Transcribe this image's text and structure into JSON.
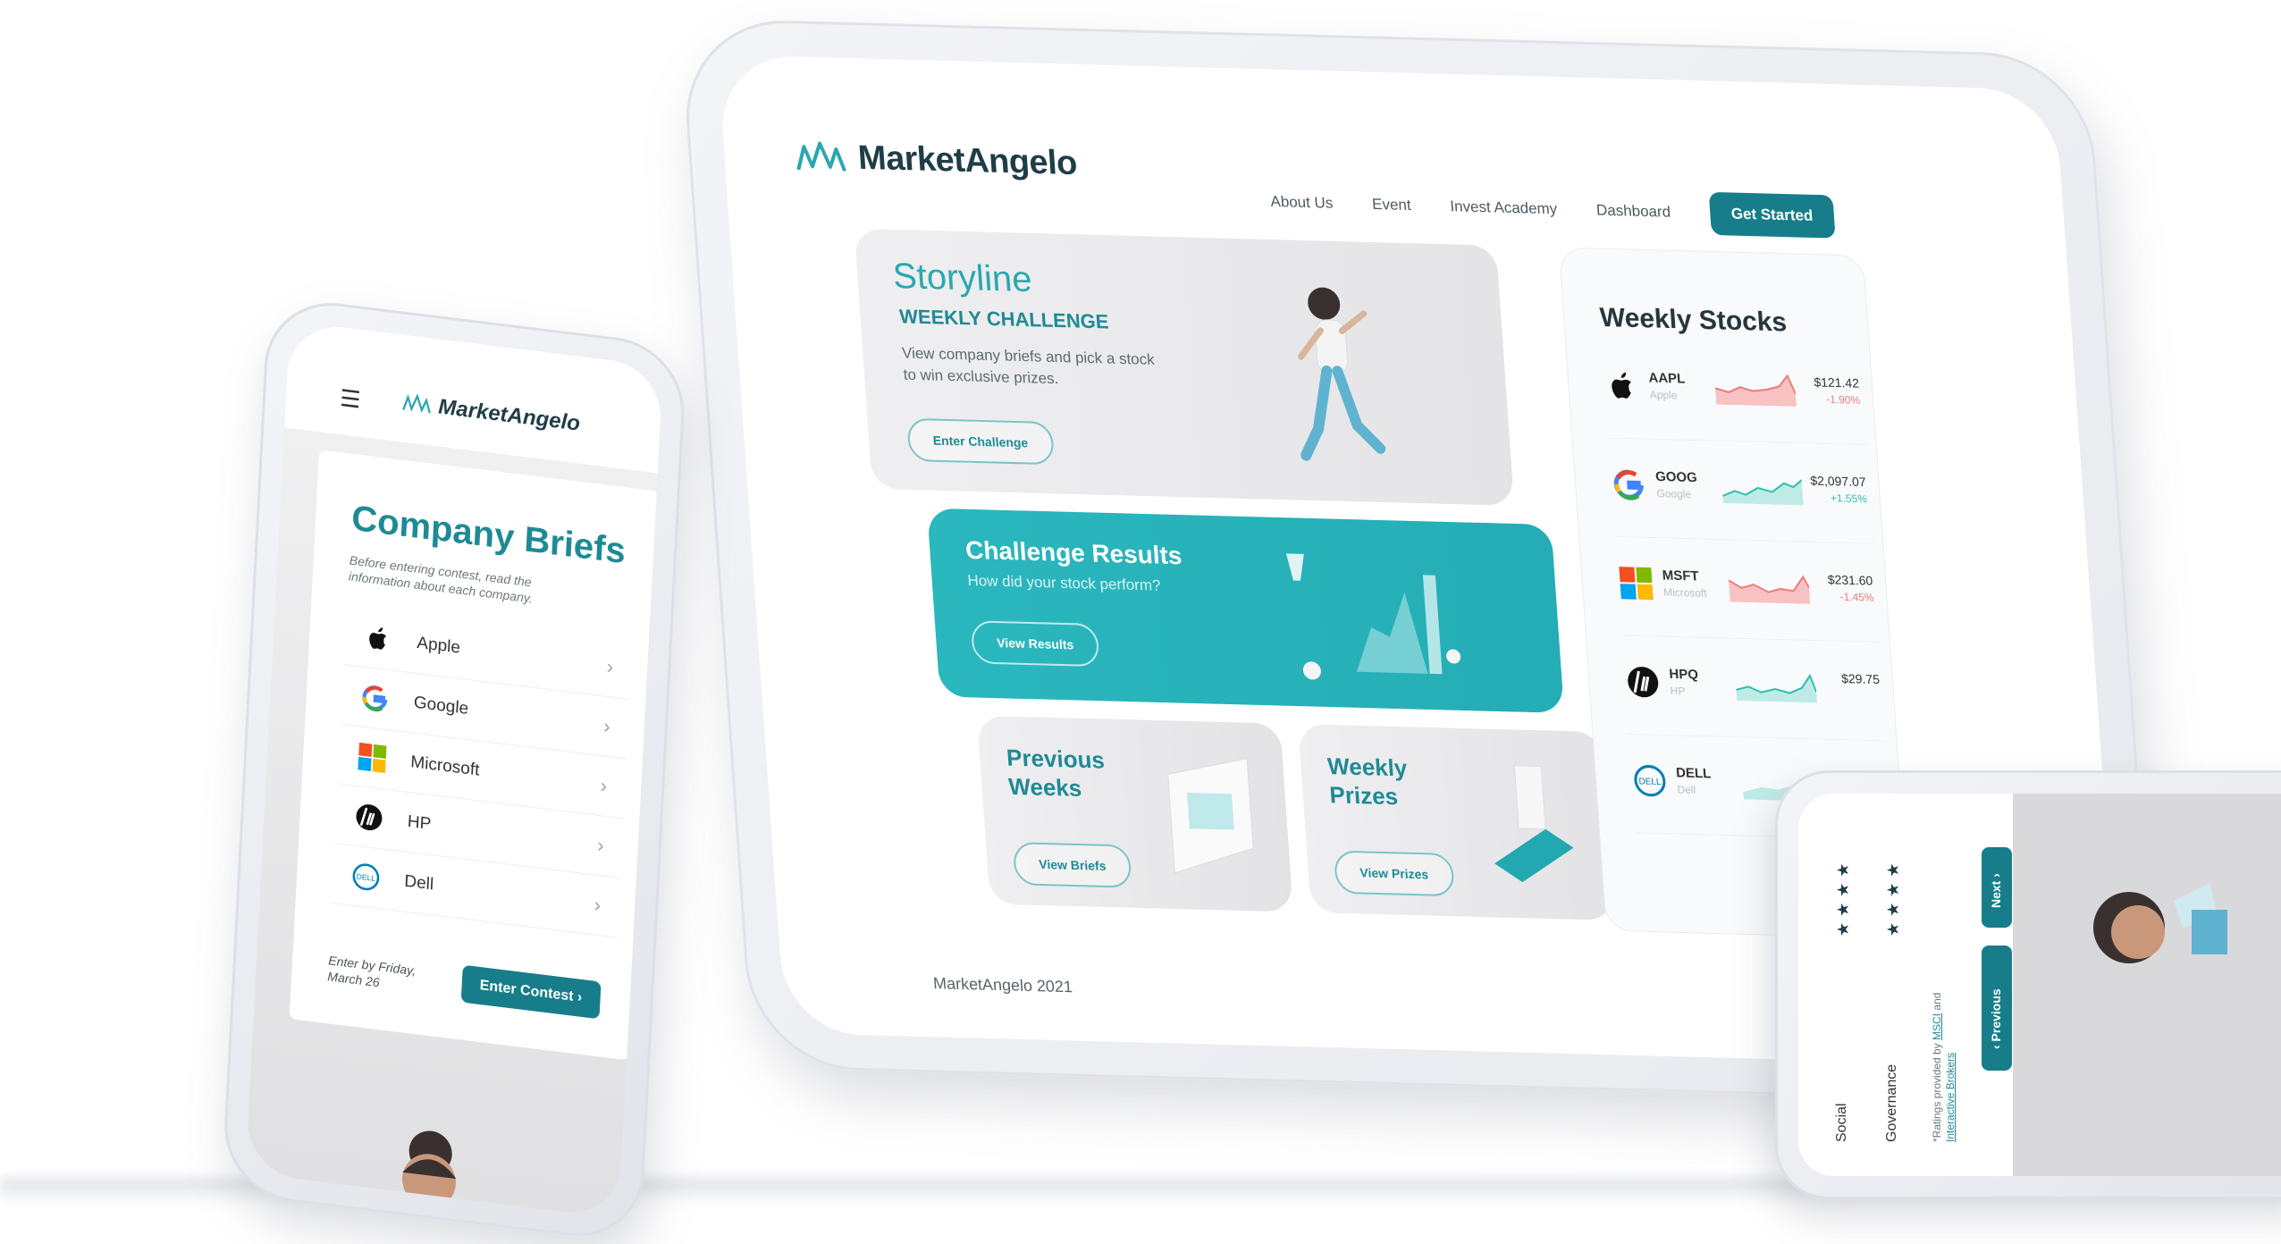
{
  "tablet": {
    "logo_text": "MarketAngelo",
    "nav": [
      "About Us",
      "Event",
      "Invest Academy",
      "Dashboard"
    ],
    "cta": "Get Started",
    "storyline": {
      "title": "Storyline",
      "subtitle": "WEEKLY CHALLENGE",
      "desc": "View company briefs and pick a stock to win exclusive prizes.",
      "button": "Enter Challenge"
    },
    "results": {
      "title": "Challenge Results",
      "sub": "How did your stock perform?",
      "button": "View Results"
    },
    "previous": {
      "title": "Previous Weeks",
      "button": "View Briefs"
    },
    "prizes": {
      "title": "Weekly Prizes",
      "button": "View Prizes"
    },
    "stocks": {
      "title": "Weekly Stocks",
      "items": [
        {
          "ticker": "AAPL",
          "name": "Apple",
          "price": "$121.42",
          "change": "-1.90%",
          "trend": "down",
          "color": "#f07a7a"
        },
        {
          "ticker": "GOOG",
          "name": "Google",
          "price": "$2,097.07",
          "change": "+1.55%",
          "trend": "up",
          "color": "#2fbfae"
        },
        {
          "ticker": "MSFT",
          "name": "Microsoft",
          "price": "$231.60",
          "change": "-1.45%",
          "trend": "down",
          "color": "#f07a7a"
        },
        {
          "ticker": "HPQ",
          "name": "HP",
          "price": "$29.75",
          "change": "",
          "trend": "up",
          "color": "#2fbfae"
        },
        {
          "ticker": "DELL",
          "name": "Dell",
          "price": "",
          "change": "",
          "trend": "up",
          "color": "#2fbfae"
        }
      ]
    },
    "footer": "MarketAngelo 2021"
  },
  "phone_left": {
    "logo_text": "MarketAngelo",
    "title": "Company Briefs",
    "sub": "Before entering contest, read the information about each company.",
    "companies": [
      "Apple",
      "Google",
      "Microsoft",
      "HP",
      "Dell"
    ],
    "enter_note": "Enter by Friday, March 26",
    "button": "Enter Contest ›"
  },
  "phone_right": {
    "social": "Social",
    "governance": "Governance",
    "note_prefix": "*Ratings provided by",
    "note_link1": "MSCI",
    "note_mid": "and",
    "note_link2": "Interactive Brokers",
    "next": "Next ›",
    "prev": "‹ Previous"
  },
  "colors": {
    "brand": "#177d8a",
    "accent": "#2bb7be",
    "up": "#2fbfae",
    "down": "#f07a7a"
  }
}
